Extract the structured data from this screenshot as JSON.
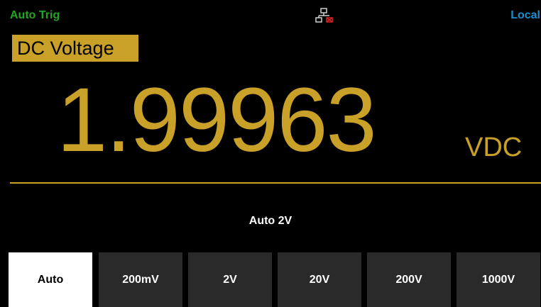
{
  "status_bar": {
    "trigger_mode": "Auto Trig",
    "remote_state": "Local",
    "network_icon": "network-disconnected-icon"
  },
  "measurement": {
    "function": "DC Voltage",
    "reading": "1.99963",
    "unit": "VDC",
    "range_status": "Auto  2V"
  },
  "softkeys": [
    {
      "label": "Auto",
      "selected": true
    },
    {
      "label": "200mV",
      "selected": false
    },
    {
      "label": "2V",
      "selected": false
    },
    {
      "label": "20V",
      "selected": false
    },
    {
      "label": "200V",
      "selected": false
    },
    {
      "label": "1000V",
      "selected": false
    }
  ],
  "colors": {
    "background": "#000000",
    "accent_gold": "#c9a028",
    "trigger_green": "#1fa81f",
    "local_blue": "#1a8fd0",
    "softkey_bg": "#2a2a2a",
    "softkey_selected_bg": "#ffffff"
  }
}
